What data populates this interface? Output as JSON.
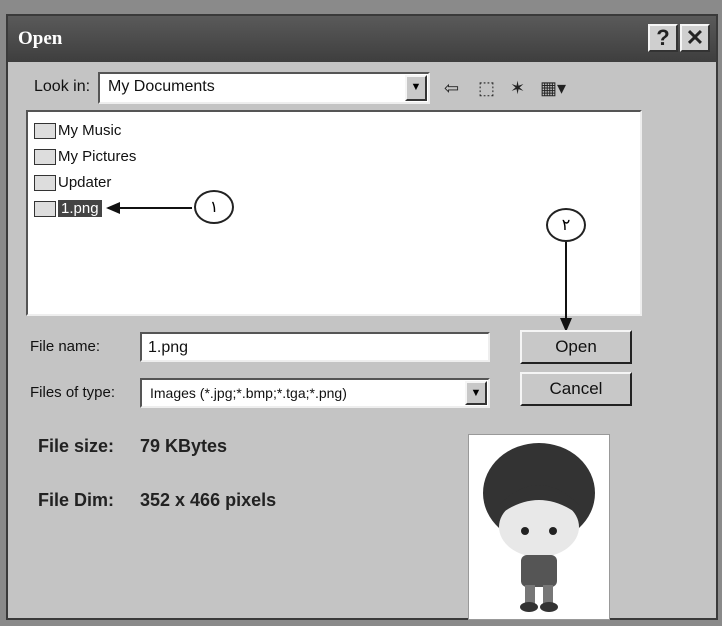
{
  "window": {
    "title": "Open"
  },
  "titlebar": {
    "help": "?",
    "close": "✕"
  },
  "lookin": {
    "label": "Look in:",
    "value": "My Documents"
  },
  "toolbar": {
    "back": "⇦",
    "up": "⬚",
    "newfolder": "✶",
    "view": "▦▾"
  },
  "files": [
    {
      "name": "My Music"
    },
    {
      "name": "My Pictures"
    },
    {
      "name": "Updater"
    },
    {
      "name": "1.png"
    }
  ],
  "annotations": {
    "one": "١",
    "two": "٢"
  },
  "filename": {
    "label": "File name:",
    "value": "1.png"
  },
  "filetype": {
    "label": "Files of type:",
    "value": "Images (*.jpg;*.bmp;*.tga;*.png)"
  },
  "buttons": {
    "open": "Open",
    "cancel": "Cancel"
  },
  "info": {
    "size_label": "File size:",
    "size_value": "79 KBytes",
    "dim_label": "File Dim:",
    "dim_value": "352 x 466 pixels"
  }
}
